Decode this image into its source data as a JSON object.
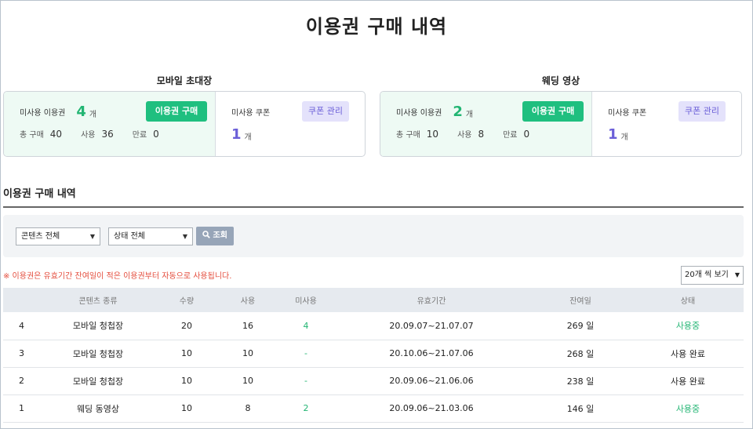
{
  "page_title": "이용권 구매 내역",
  "summaries": [
    {
      "title": "모바일 초대장",
      "unused_ticket_label": "미사용 이용권",
      "unused_ticket_count": "4",
      "unit": "개",
      "buy_button": "이용권 구매",
      "total_label": "총 구매",
      "total": "40",
      "used_label": "사용",
      "used": "36",
      "expired_label": "만료",
      "expired": "0",
      "coupon_label": "미사용 쿠폰",
      "coupon_button": "쿠폰 관리",
      "coupon_count": "1"
    },
    {
      "title": "웨딩 영상",
      "unused_ticket_label": "미사용 이용권",
      "unused_ticket_count": "2",
      "unit": "개",
      "buy_button": "이용권 구매",
      "total_label": "총 구매",
      "total": "10",
      "used_label": "사용",
      "used": "8",
      "expired_label": "만료",
      "expired": "0",
      "coupon_label": "미사용 쿠폰",
      "coupon_button": "쿠폰 관리",
      "coupon_count": "1"
    }
  ],
  "section_title": "이용권 구매 내역",
  "filters": {
    "content_select": "콘텐츠 전체",
    "status_select": "상태 전체",
    "search_button": "조회"
  },
  "notice": "※ 이용권은 유효기간 잔여일이 적은 이용권부터 자동으로 사용됩니다.",
  "per_page": "20개 씩 보기",
  "table": {
    "headers": [
      "",
      "콘텐츠 종류",
      "수량",
      "사용",
      "미사용",
      "유효기간",
      "잔여일",
      "상태"
    ],
    "rows": [
      [
        "4",
        "모바일 청첩장",
        "20",
        "16",
        "4",
        "20.09.07~21.07.07",
        "269 일",
        "사용중"
      ],
      [
        "3",
        "모바일 청첩장",
        "10",
        "10",
        "-",
        "20.10.06~21.07.06",
        "268 일",
        "사용 완료"
      ],
      [
        "2",
        "모바일 청첩장",
        "10",
        "10",
        "-",
        "20.09.06~21.06.06",
        "238 일",
        "사용 완료"
      ],
      [
        "1",
        "웨딩 동영상",
        "10",
        "8",
        "2",
        "20.09.06~21.03.06",
        "146 일",
        "사용중"
      ]
    ]
  },
  "colors": {
    "accent_green": "#1fbf7f",
    "accent_purple": "#6b5fd8",
    "notice_red": "#e44c3c"
  }
}
